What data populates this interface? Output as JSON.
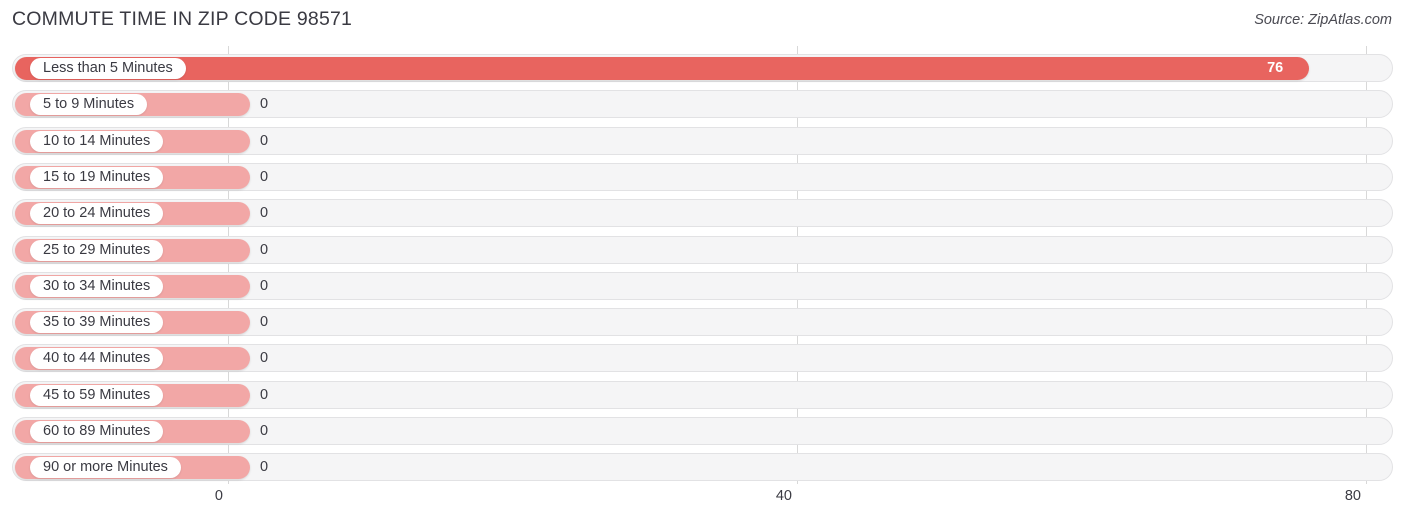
{
  "header": {
    "title": "COMMUTE TIME IN ZIP CODE 98571",
    "source": "Source: ZipAtlas.com"
  },
  "colors": {
    "bar_filled": "#e8645f",
    "bar_empty": "#f2a7a6",
    "track": "#f5f5f6",
    "gridline": "#d8d8d8",
    "text": "#3a3a42",
    "value_in_bar": "#ffffff"
  },
  "chart_data": {
    "type": "bar",
    "orientation": "horizontal",
    "title": "COMMUTE TIME IN ZIP CODE 98571",
    "subtitle": "",
    "xlabel": "",
    "ylabel": "",
    "xlim": [
      0,
      80
    ],
    "xticks": [
      0,
      40,
      80
    ],
    "xtick_labels": [
      "0",
      "40",
      "80"
    ],
    "grid": true,
    "legend": false,
    "annotation": "Source: ZipAtlas.com",
    "categories": [
      "Less than 5 Minutes",
      "5 to 9 Minutes",
      "10 to 14 Minutes",
      "15 to 19 Minutes",
      "20 to 24 Minutes",
      "25 to 29 Minutes",
      "30 to 34 Minutes",
      "35 to 39 Minutes",
      "40 to 44 Minutes",
      "45 to 59 Minutes",
      "60 to 89 Minutes",
      "90 or more Minutes"
    ],
    "values": [
      76,
      0,
      0,
      0,
      0,
      0,
      0,
      0,
      0,
      0,
      0,
      0
    ],
    "value_labels": [
      "76",
      "0",
      "0",
      "0",
      "0",
      "0",
      "0",
      "0",
      "0",
      "0",
      "0",
      "0"
    ]
  }
}
